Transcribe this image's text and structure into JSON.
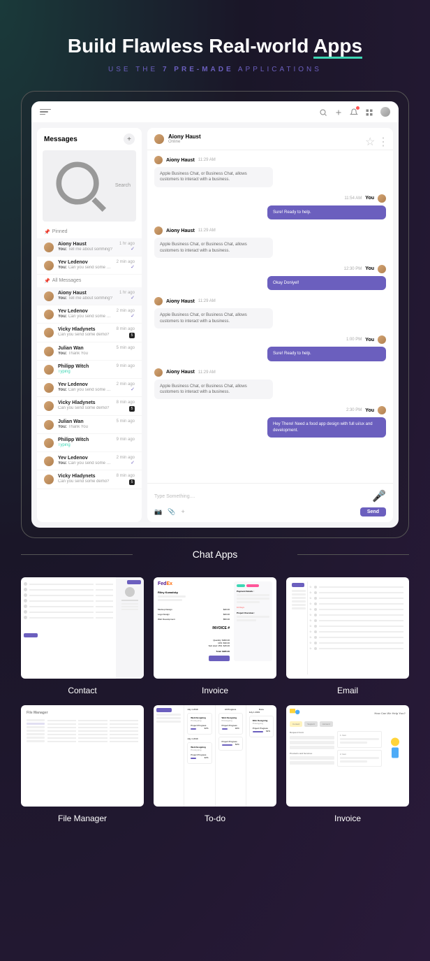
{
  "hero": {
    "title_pre": "Build Flawless Real-world ",
    "title_highlight": "Apps",
    "subtitle_pre": "USE THE ",
    "subtitle_bold": "7 PRE-MADE",
    "subtitle_post": " APPLICATIONS"
  },
  "messages_panel": {
    "title": "Messages",
    "search": "Search",
    "pinned": "Pinned",
    "all": "All Messages"
  },
  "conversations": [
    {
      "name": "Aiony Haust",
      "text": "Tell me about somhing?",
      "time": "1 hr ago",
      "you": true,
      "check": true,
      "active": true
    },
    {
      "name": "Yev Ledenov",
      "text": "Can you send some demo?",
      "time": "2 min ago",
      "you": true,
      "check": true
    }
  ],
  "all_conversations": [
    {
      "name": "Aiony Haust",
      "text": "Tell me about somhing?",
      "time": "1 hr ago",
      "you": true,
      "check": true,
      "active": true
    },
    {
      "name": "Yev Ledenov",
      "text": "Can you send some demo?",
      "time": "2 min ago",
      "you": true,
      "check": true
    },
    {
      "name": "Vicky Hladynets",
      "text": "Can you send some demo?",
      "time": "8 min ago",
      "badge": "5"
    },
    {
      "name": "Julian Wan",
      "text": "Thank You",
      "time": "5 min ago",
      "you": true
    },
    {
      "name": "Philipp Witch",
      "text": "Typing",
      "time": "9 min ago",
      "typing": true
    },
    {
      "name": "Yev Ledenov",
      "text": "Can you send some demo?",
      "time": "2 min ago",
      "you": true,
      "check": true
    },
    {
      "name": "Vicky Hladynets",
      "text": "Can you send some demo?",
      "time": "8 min ago",
      "badge": "5"
    },
    {
      "name": "Julian Wan",
      "text": "Thank You",
      "time": "5 min ago",
      "you": true
    },
    {
      "name": "Philipp Witch",
      "text": "Typing",
      "time": "9 min ago",
      "typing": true
    },
    {
      "name": "Yev Ledenov",
      "text": "Can you send some demo?",
      "time": "2 min ago",
      "you": true,
      "check": true
    },
    {
      "name": "Vicky Hladynets",
      "text": "Can you send some demo?",
      "time": "8 min ago",
      "badge": "5"
    }
  ],
  "chat": {
    "name": "Aiony Haust",
    "status": "Online",
    "messages": [
      {
        "from": "Aiony Haust",
        "time": "11:29 AM",
        "text": "Apple Business Chat, or Business Chat, allows customers to interact with a business."
      },
      {
        "from": "You",
        "time": "11:54 AM",
        "text": "Sure! Ready to help.",
        "right": true
      },
      {
        "from": "Aiony Haust",
        "time": "11:29 AM",
        "text": "Apple Business Chat, or Business Chat, allows customers to interact with a business."
      },
      {
        "from": "You",
        "time": "12:30 PM",
        "text": "Okay Doniyel!",
        "right": true
      },
      {
        "from": "Aiony Haust",
        "time": "11:29 AM",
        "text": "Apple Business Chat, or Business Chat, allows customers to interact with a business."
      },
      {
        "from": "You",
        "time": "1:00 PM",
        "text": "Sure! Ready to help.",
        "right": true
      },
      {
        "from": "Aiony Haust",
        "time": "11:29 AM",
        "text": "Apple Business Chat, or Business Chat, allows customers to interact with a business."
      },
      {
        "from": "You",
        "time": "2:30 PM",
        "text": "Hey There! Need a food app design with full ui/ux and development.",
        "right": true
      }
    ],
    "placeholder": "Type Something....",
    "send": "Send"
  },
  "main_label": "Chat Apps",
  "thumbs": [
    "Contact",
    "Invoice",
    "Email",
    "File Manager",
    "To-do",
    "Invoice"
  ]
}
